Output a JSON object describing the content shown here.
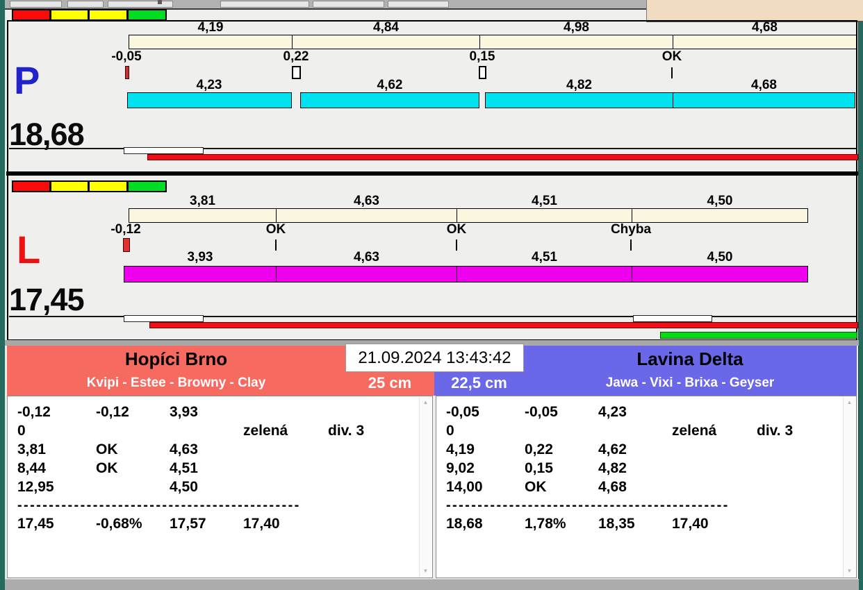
{
  "window": {
    "datetime": "21.09.2024 13:43:42"
  },
  "lanes": {
    "p": {
      "letter": "P",
      "total": "18,68",
      "plan_segments": [
        "4,19",
        "4,84",
        "4,98",
        "4,68"
      ],
      "marks": [
        "-0,05",
        "0,22",
        "0,15",
        "OK"
      ],
      "actual_segments": [
        "4,23",
        "4,62",
        "4,82",
        "4,68"
      ]
    },
    "l": {
      "letter": "L",
      "total": "17,45",
      "plan_segments": [
        "3,81",
        "4,63",
        "4,51",
        "4,50"
      ],
      "marks": [
        "-0,12",
        "OK",
        "OK",
        "Chyba"
      ],
      "actual_segments": [
        "3,93",
        "4,63",
        "4,51",
        "4,50"
      ]
    }
  },
  "teams": {
    "left": {
      "name": "Hopíci Brno",
      "roster": "Kvipi - Estee - Browny - Clay",
      "distance": "25 cm",
      "rows": [
        [
          "-0,12",
          "-0,12",
          "3,93",
          "",
          ""
        ],
        [
          "0",
          "",
          "",
          "zelená",
          "div. 3"
        ],
        [
          "3,81",
          "OK",
          "4,63",
          "",
          ""
        ],
        [
          "8,44",
          "OK",
          "4,51",
          "",
          ""
        ],
        [
          "12,95",
          "",
          "4,50",
          "",
          ""
        ]
      ],
      "separator": "---------------------------------------------",
      "summary": [
        "17,45",
        "-0,68%",
        "17,57",
        "17,40"
      ]
    },
    "right": {
      "name": "Lavina Delta",
      "roster": "Jawa - Vixi - Brixa - Geyser",
      "distance": "22,5 cm",
      "rows": [
        [
          "-0,05",
          "-0,05",
          "4,23",
          "",
          ""
        ],
        [
          "0",
          "",
          "",
          "zelená",
          "div. 3"
        ],
        [
          "4,19",
          "0,22",
          "4,62",
          "",
          ""
        ],
        [
          "9,02",
          "0,15",
          "4,82",
          "",
          ""
        ],
        [
          "14,00",
          "OK",
          "4,68",
          "",
          ""
        ]
      ],
      "separator": "---------------------------------------------",
      "summary": [
        "18,68",
        "1,78%",
        "18,35",
        "17,40"
      ]
    }
  },
  "colors": {
    "traffic_red": "#fb0a0a",
    "traffic_yellow": "#ffff00",
    "traffic_green": "#00dd22",
    "plan_bar": "#fbf7df",
    "p_actual_bar": "#00e1ef",
    "l_actual_bar": "#ee00ee",
    "p_letter": "#2222cc",
    "l_letter": "#ee1111",
    "progress_red": "#ee1016",
    "progress_green": "#00dd11",
    "team_left_bg": "#f76a60",
    "team_right_bg": "#6a68e8"
  }
}
